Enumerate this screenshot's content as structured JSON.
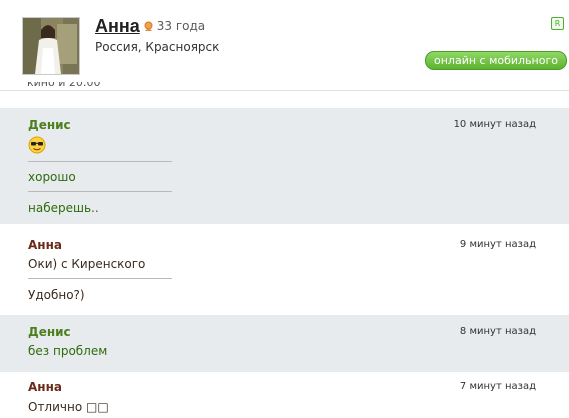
{
  "profile": {
    "name": "Анна",
    "age": "33 года",
    "location": "Россия, Красноярск",
    "r_badge": "R",
    "online_status": "онлайн с мобильного",
    "gender_icon": "female-icon"
  },
  "colors": {
    "denis_name": "#4c7f1d",
    "anna_name": "#6b2a1a",
    "online_green": "#6fc043",
    "gray_row": "#e8ebee"
  },
  "messages": [
    {
      "sender": "Денис",
      "time": "10 минут назад",
      "lines": [
        "😎",
        "хорошо",
        "наберешь.."
      ]
    },
    {
      "sender": "Анна",
      "time": "9 минут назад",
      "lines": [
        "Оки) с Киренского",
        "Удобно?)"
      ]
    },
    {
      "sender": "Денис",
      "time": "8 минут назад",
      "lines": [
        "без проблем"
      ]
    },
    {
      "sender": "Анна",
      "time": "7 минут назад",
      "lines": [
        "Отлично □□"
      ]
    }
  ]
}
